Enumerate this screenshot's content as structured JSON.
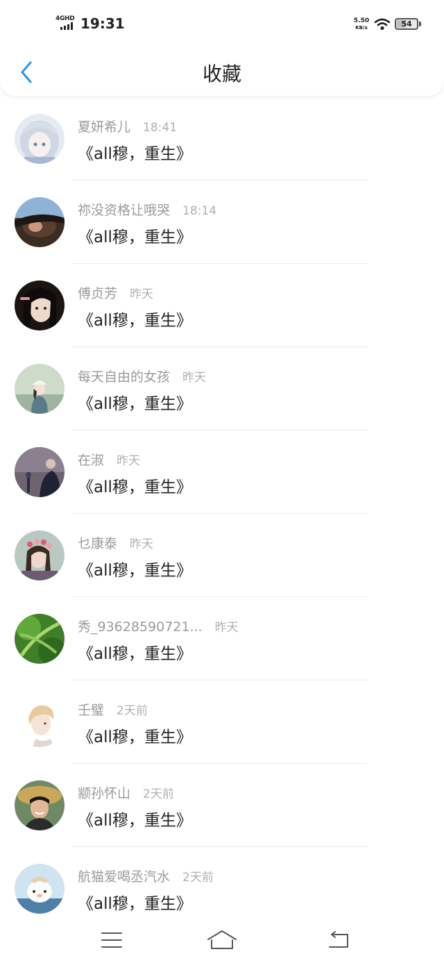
{
  "status_bar": {
    "network_type": "4GHD",
    "time": "19:31",
    "net_speed_value": "5.50",
    "net_speed_unit": "KB/s",
    "battery_level": "54",
    "battery_fraction": 0.54
  },
  "header": {
    "title": "收藏",
    "back_icon": "chevron-left-icon"
  },
  "items": [
    {
      "name": "夏妍希儿",
      "time": "18:41",
      "content": "《all穆，重生》"
    },
    {
      "name": "祢没资格让哦哭",
      "time": "18:14",
      "content": "《all穆，重生》"
    },
    {
      "name": "傅贞芳",
      "time": "昨天",
      "content": "《all穆，重生》"
    },
    {
      "name": "每天自由的女孩",
      "time": "昨天",
      "content": "《all穆，重生》"
    },
    {
      "name": "在淑",
      "time": "昨天",
      "content": "《all穆，重生》"
    },
    {
      "name": "乜康泰",
      "time": "昨天",
      "content": "《all穆，重生》"
    },
    {
      "name": "秀_93628590721...",
      "time": "昨天",
      "content": "《all穆，重生》"
    },
    {
      "name": "壬璧",
      "time": "2天前",
      "content": "《all穆，重生》"
    },
    {
      "name": "颛孙怀山",
      "time": "2天前",
      "content": "《all穆，重生》"
    },
    {
      "name": "航猫爱喝丞汽水",
      "time": "2天前",
      "content": "《all穆，重生》"
    }
  ],
  "bottom_nav": {
    "menu_icon": "menu-icon",
    "home_icon": "home-icon",
    "back_icon": "back-arrow-icon"
  },
  "colors": {
    "accent": "#2196f3",
    "text_primary": "#222222",
    "text_secondary": "#9a9a9a",
    "divider": "#ececec"
  }
}
